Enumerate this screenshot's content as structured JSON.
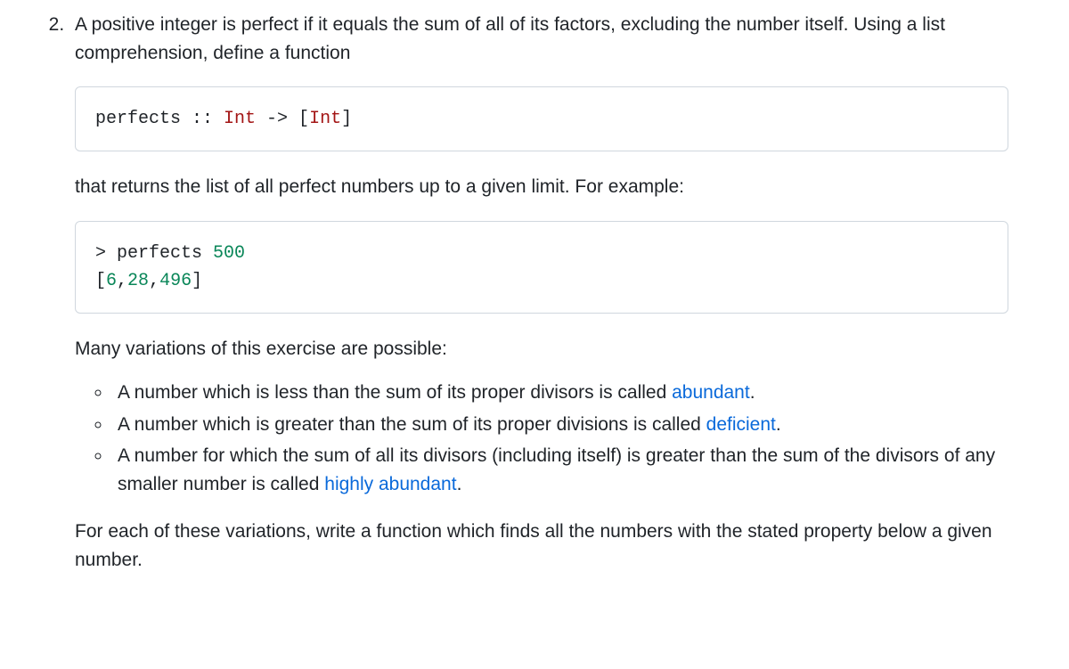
{
  "item_number_start": 2,
  "intro": "A positive integer is perfect if it equals the sum of all of its factors, excluding the number itself. Using a list comprehension, define a function",
  "code1": {
    "plain1": "perfects :: ",
    "type1": "Int",
    "plain2": " -> [",
    "type2": "Int",
    "plain3": "]"
  },
  "mid1": "that returns the list of all perfect numbers up to a given limit. For example:",
  "code2": {
    "line1_prompt": "> perfects ",
    "line1_num": "500",
    "line2_open": "[",
    "line2_n1": "6",
    "line2_c1": ",",
    "line2_n2": "28",
    "line2_c2": ",",
    "line2_n3": "496",
    "line2_close": "]"
  },
  "variations_intro": "Many variations of this exercise are possible:",
  "bullets": {
    "b1_pre": "A number which is less than the sum of its proper divisors is called ",
    "b1_link": "abundant",
    "b1_post": ".",
    "b2_pre": "A number which is greater than the sum of its proper divisions is called ",
    "b2_link": "deficient",
    "b2_post": ".",
    "b3_pre": "A number for which the sum of all its divisors (including itself) is greater than the sum of the divisors of any smaller number is called ",
    "b3_link": "highly abundant",
    "b3_post": "."
  },
  "outro": "For each of these variations, write a function which finds all the numbers with the stated property below a given number."
}
